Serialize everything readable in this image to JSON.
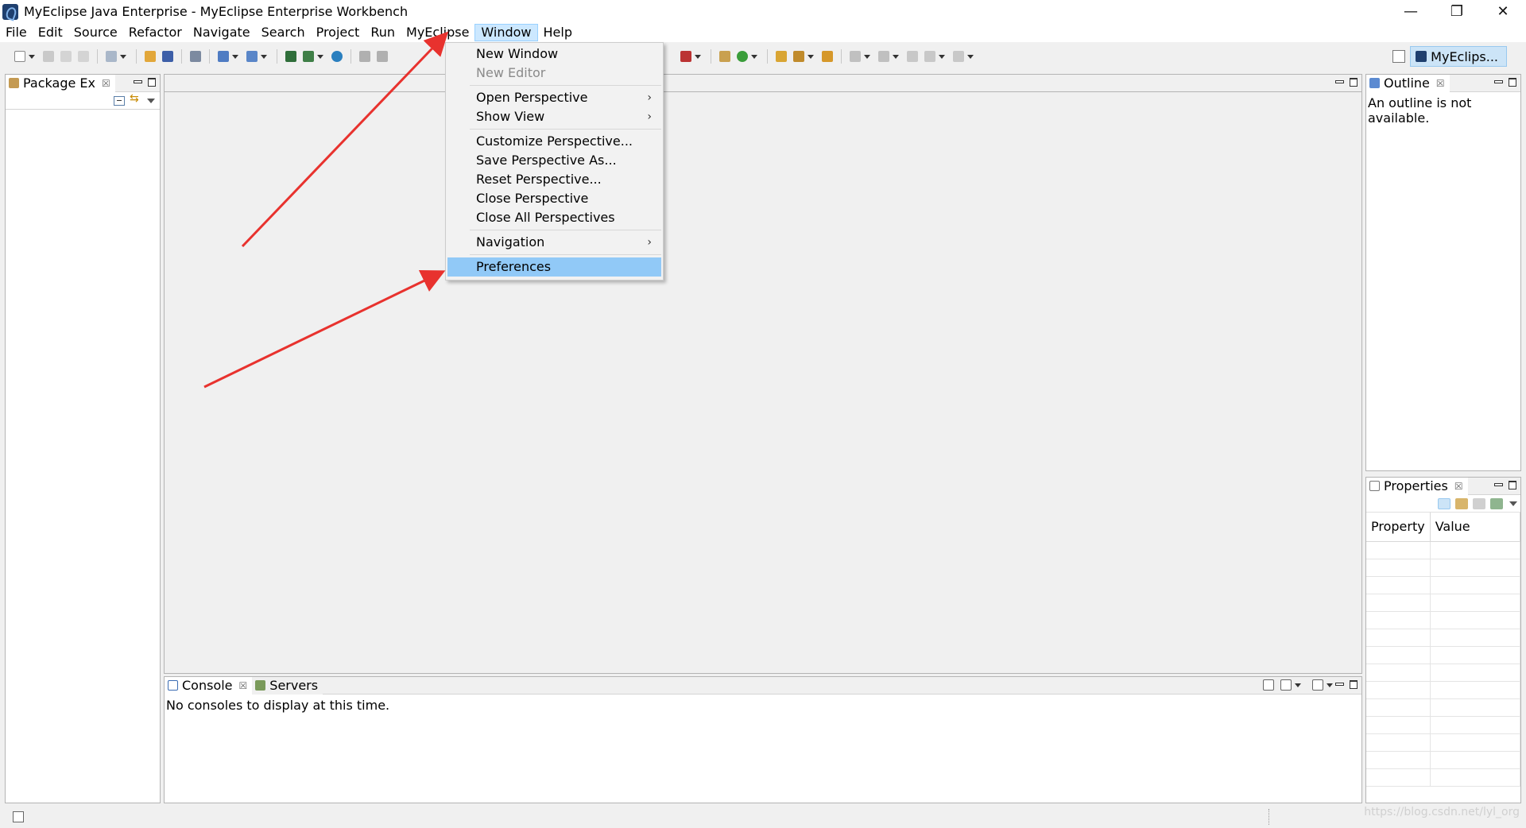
{
  "window": {
    "title": "MyEclipse Java Enterprise - MyEclipse Enterprise Workbench",
    "minimize": "—",
    "restore": "❐",
    "close": "✕"
  },
  "menubar": {
    "items": [
      "File",
      "Edit",
      "Source",
      "Refactor",
      "Navigate",
      "Search",
      "Project",
      "Run",
      "MyEclipse",
      "Window",
      "Help"
    ],
    "active": "Window"
  },
  "perspective": {
    "label": "MyEclips..."
  },
  "window_menu": {
    "new_window": "New Window",
    "new_editor": "New Editor",
    "open_perspective": "Open Perspective",
    "show_view": "Show View",
    "customize_perspective": "Customize Perspective...",
    "save_perspective_as": "Save Perspective As...",
    "reset_perspective": "Reset Perspective...",
    "close_perspective": "Close Perspective",
    "close_all_perspectives": "Close All Perspectives",
    "navigation": "Navigation",
    "preferences": "Preferences",
    "submenu_arrow": "›"
  },
  "package_explorer": {
    "tab_label": "Package Ex",
    "close": "☒"
  },
  "outline": {
    "tab_label": "Outline",
    "close": "☒",
    "message": "An outline is not available."
  },
  "properties": {
    "tab_label": "Properties",
    "close": "☒",
    "col_property": "Property",
    "col_value": "Value"
  },
  "console": {
    "tab_label": "Console",
    "close": "☒",
    "servers_label": "Servers",
    "message": "No consoles to display at this time."
  },
  "watermark": "https://blog.csdn.net/lyl_org",
  "colors": {
    "accent": "#91c9f7",
    "arrow": "#e8322e",
    "menu_active": "#cce8ff"
  },
  "icons": [
    "app-icon",
    "minimize-icon",
    "restore-icon",
    "close-icon",
    "new-icon",
    "save-icon",
    "run-icon",
    "submenu-arrow-icon",
    "collapse-all-icon",
    "link-editor-icon",
    "view-menu-icon",
    "minimize-view-icon",
    "maximize-view-icon"
  ]
}
